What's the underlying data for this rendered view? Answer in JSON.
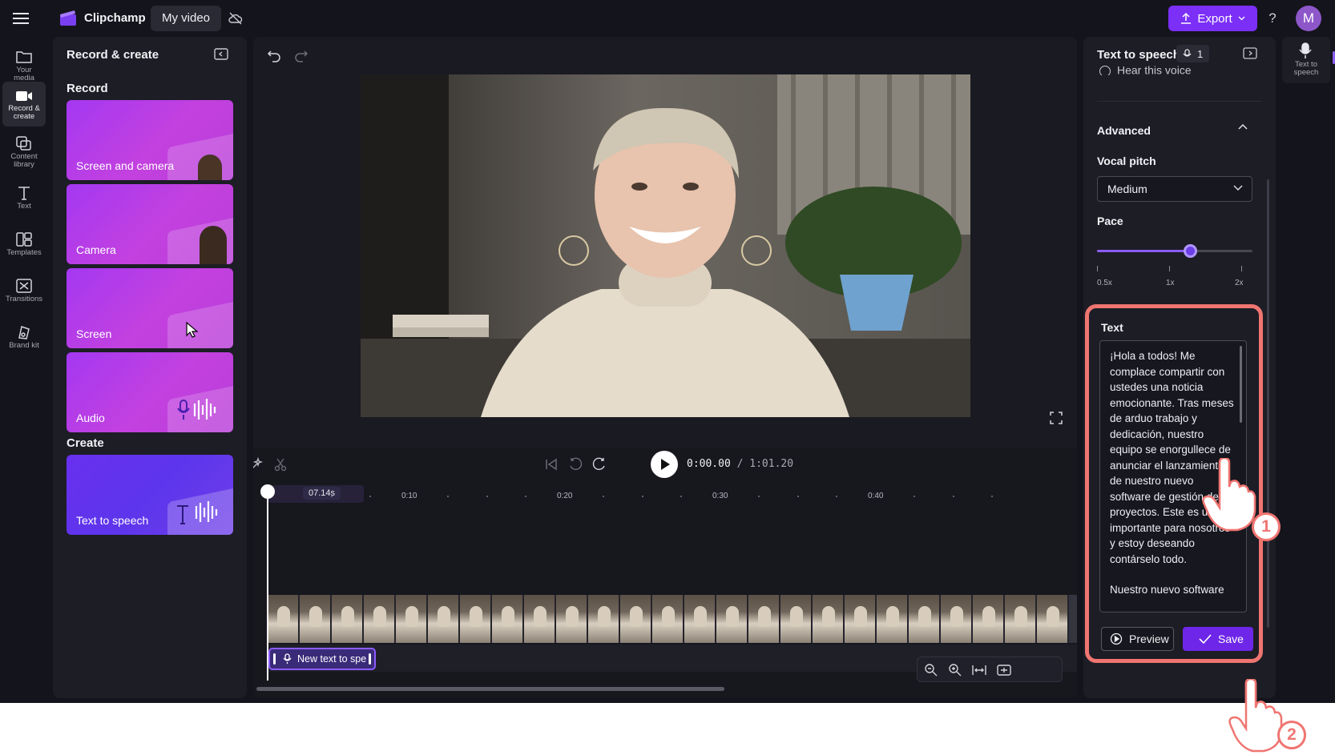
{
  "header": {
    "app_name": "Clipchamp",
    "project_name": "My video",
    "export_label": "Export",
    "help_glyph": "?",
    "avatar_initial": "M"
  },
  "rail": {
    "items": [
      {
        "label_line1": "Your",
        "label_line2": "media",
        "icon": "folder-icon"
      },
      {
        "label_line1": "Record &",
        "label_line2": "create",
        "icon": "camera-icon"
      },
      {
        "label_line1": "Content",
        "label_line2": "library",
        "icon": "library-icon"
      },
      {
        "label_line1": "Text",
        "label_line2": "",
        "icon": "text-icon"
      },
      {
        "label_line1": "Templates",
        "label_line2": "",
        "icon": "templates-icon"
      },
      {
        "label_line1": "Transitions",
        "label_line2": "",
        "icon": "transitions-icon"
      },
      {
        "label_line1": "Brand kit",
        "label_line2": "",
        "icon": "brand-kit-icon"
      }
    ]
  },
  "left_panel": {
    "title": "Record & create",
    "record_section": "Record",
    "create_section": "Create",
    "cards": {
      "screen_and_camera": "Screen and camera",
      "camera": "Camera",
      "screen": "Screen",
      "audio": "Audio",
      "text_to_speech": "Text to speech"
    }
  },
  "timeline": {
    "current_time": "0:00.00",
    "total_time": "/ 1:01.20",
    "playhead_label": "07.14s",
    "ruler_labels": [
      "0:10",
      "0:20",
      "0:30",
      "0:40"
    ],
    "tts_clip_label": "New text to spe"
  },
  "properties": {
    "title": "Text to speech",
    "voice_count": "1",
    "hear_voice_label": "Hear this voice",
    "advanced_label": "Advanced",
    "vocal_pitch_label": "Vocal pitch",
    "vocal_pitch_value": "Medium",
    "pace_label": "Pace",
    "pace_value": 1.2,
    "pace_min": 0.5,
    "pace_max": 2,
    "pace_ticks": [
      "0.5x",
      "1x",
      "2x"
    ],
    "text_label": "Text",
    "text_value": "¡Hola a todos! Me complace compartir con ustedes una noticia emocionante. Tras meses de arduo trabajo y dedicación, nuestro equipo se enorgullece de anunciar el lanzamiento de nuestro nuevo software de gestión de proyectos. Este es un hito importante para nosotros y estoy deseando contárselo todo.",
    "text_overflow": "Nuestro nuevo software",
    "preview_label": "Preview",
    "save_label": "Save"
  },
  "right_rail": {
    "label_line1": "Text to",
    "label_line2": "speech"
  },
  "callouts": {
    "step1": "1",
    "step2": "2"
  },
  "colors": {
    "accent": "#7b2ff7",
    "callout": "#ef7571",
    "background": "#14141c",
    "panel": "#1d1d26"
  }
}
